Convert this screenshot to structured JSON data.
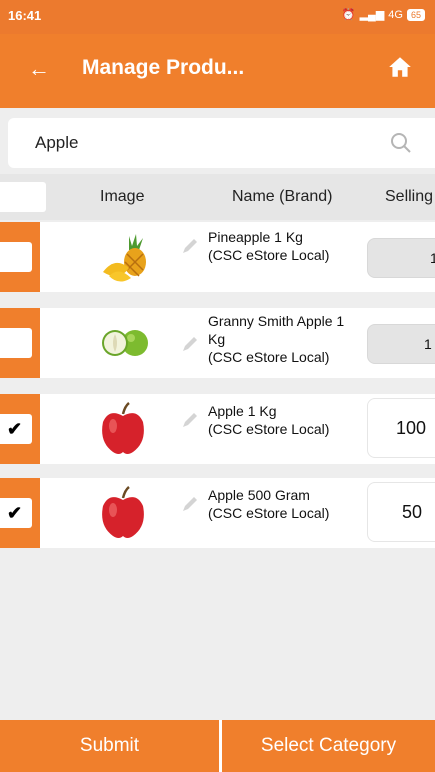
{
  "status_bar": {
    "time": "16:41",
    "network": "4G",
    "signal_icon": "signal-icon",
    "alarm_icon": "alarm-icon",
    "battery_label": "65"
  },
  "app_bar": {
    "title": "Manage Produ...",
    "back_icon": "back-arrow-icon",
    "home_icon": "home-icon"
  },
  "search": {
    "value": "Apple",
    "icon": "search-icon"
  },
  "table": {
    "columns": [
      "Image",
      "Name (Brand)",
      "Selling"
    ],
    "rows": [
      {
        "checked": false,
        "image": "pineapple",
        "name_lines": [
          "Pineapple 1 Kg",
          "(CSC eStore Local)"
        ],
        "price": "1",
        "price_editable": false
      },
      {
        "checked": false,
        "image": "green-apple",
        "name_lines": [
          "Granny Smith Apple 1",
          "Kg",
          "(CSC eStore Local)"
        ],
        "price": "1",
        "price_editable": false
      },
      {
        "checked": true,
        "image": "red-apple",
        "name_lines": [
          "Apple 1 Kg",
          "(CSC eStore Local)"
        ],
        "price": "100",
        "price_editable": true
      },
      {
        "checked": true,
        "image": "red-apple",
        "name_lines": [
          "Apple 500 Gram",
          "(CSC eStore Local)"
        ],
        "price": "50",
        "price_editable": true
      }
    ]
  },
  "footer": {
    "submit_label": "Submit",
    "select_category_label": "Select Category"
  },
  "colors": {
    "primary": "#f07f2c",
    "background": "#eeeeee"
  }
}
